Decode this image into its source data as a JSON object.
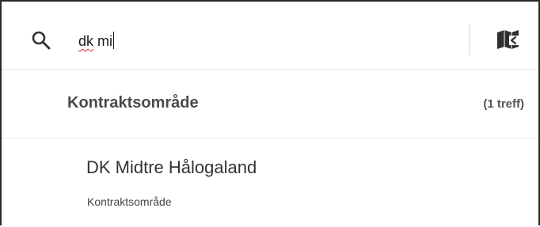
{
  "search": {
    "query_underlined": "dk",
    "query_rest": " mi"
  },
  "icons": {
    "search": "search-icon",
    "map_book": "map-book-icon"
  },
  "results": {
    "group_title": "Kontraktsområde",
    "group_count": "(1 treff)",
    "items": [
      {
        "title": "DK Midtre Hålogaland",
        "subtitle": "Kontraktsområde"
      }
    ]
  },
  "colors": {
    "frame_border": "#2a2a2a",
    "text": "#333333",
    "spellcheck_underline": "#d93025"
  }
}
